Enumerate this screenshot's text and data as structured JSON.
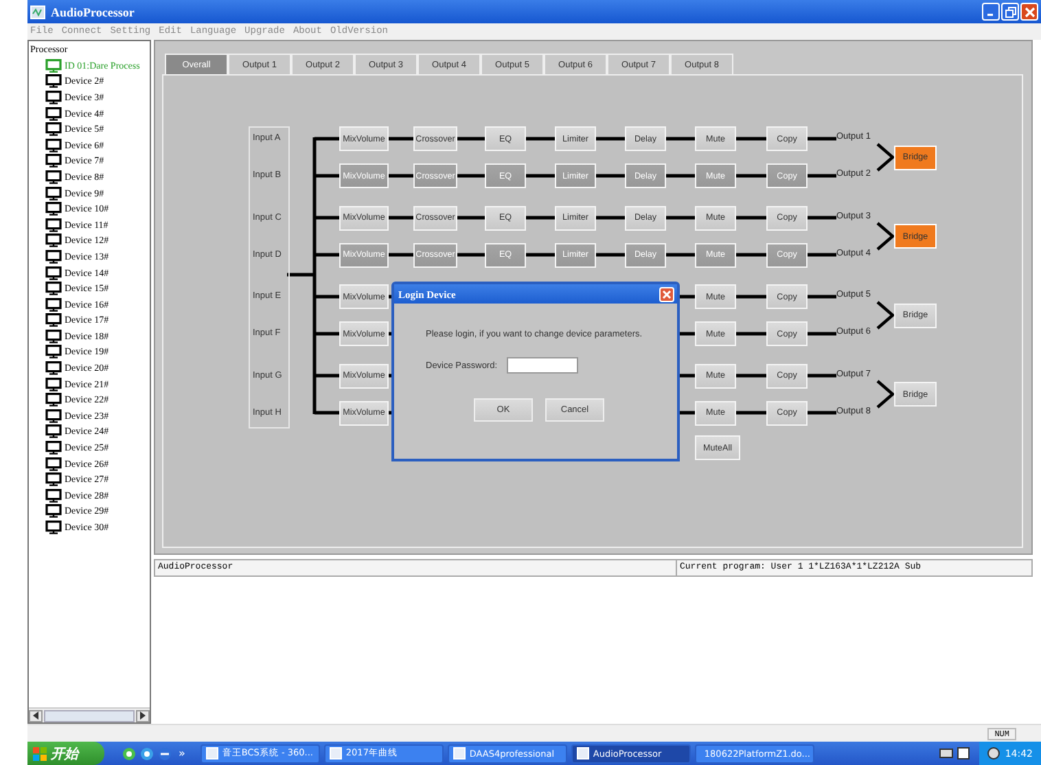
{
  "window": {
    "title": "AudioProcessor"
  },
  "menu": [
    "File",
    "Connect",
    "Setting",
    "Edit",
    "Language",
    "Upgrade",
    "About",
    "OldVersion"
  ],
  "tree": {
    "label": "Processor",
    "children": [
      {
        "label": "ID 01:Dare Process",
        "online": true
      },
      {
        "label": "Device 2#",
        "online": false
      },
      {
        "label": "Device 3#",
        "online": false
      },
      {
        "label": "Device 4#",
        "online": false
      },
      {
        "label": "Device 5#",
        "online": false
      },
      {
        "label": "Device 6#",
        "online": false
      },
      {
        "label": "Device 7#",
        "online": false
      },
      {
        "label": "Device 8#",
        "online": false
      },
      {
        "label": "Device 9#",
        "online": false
      },
      {
        "label": "Device 10#",
        "online": false
      },
      {
        "label": "Device 11#",
        "online": false
      },
      {
        "label": "Device 12#",
        "online": false
      },
      {
        "label": "Device 13#",
        "online": false
      },
      {
        "label": "Device 14#",
        "online": false
      },
      {
        "label": "Device 15#",
        "online": false
      },
      {
        "label": "Device 16#",
        "online": false
      },
      {
        "label": "Device 17#",
        "online": false
      },
      {
        "label": "Device 18#",
        "online": false
      },
      {
        "label": "Device 19#",
        "online": false
      },
      {
        "label": "Device 20#",
        "online": false
      },
      {
        "label": "Device 21#",
        "online": false
      },
      {
        "label": "Device 22#",
        "online": false
      },
      {
        "label": "Device 23#",
        "online": false
      },
      {
        "label": "Device 24#",
        "online": false
      },
      {
        "label": "Device 25#",
        "online": false
      },
      {
        "label": "Device 26#",
        "online": false
      },
      {
        "label": "Device 27#",
        "online": false
      },
      {
        "label": "Device 28#",
        "online": false
      },
      {
        "label": "Device 29#",
        "online": false
      },
      {
        "label": "Device 30#",
        "online": false
      }
    ]
  },
  "tabs": [
    {
      "label": "Overall",
      "selected": true
    },
    {
      "label": "Output 1",
      "selected": false
    },
    {
      "label": "Output 2",
      "selected": false
    },
    {
      "label": "Output 3",
      "selected": false
    },
    {
      "label": "Output 4",
      "selected": false
    },
    {
      "label": "Output 5",
      "selected": false
    },
    {
      "label": "Output 6",
      "selected": false
    },
    {
      "label": "Output 7",
      "selected": false
    },
    {
      "label": "Output 8",
      "selected": false
    }
  ],
  "inputs": [
    "Input A",
    "Input B",
    "Input C",
    "Input D",
    "Input E",
    "Input F",
    "Input G",
    "Input H"
  ],
  "channels": [
    {
      "disabled": false,
      "output": "Output 1",
      "blocks": [
        {
          "kind": "mix",
          "label": "MixVolume"
        },
        {
          "kind": "crossover",
          "label": "Crossover"
        },
        {
          "kind": "eq",
          "label": "EQ"
        },
        {
          "kind": "limiter",
          "label": "Limiter"
        },
        {
          "kind": "delay",
          "label": "Delay"
        },
        {
          "kind": "mute",
          "label": "Mute"
        },
        {
          "kind": "copy",
          "label": "Copy"
        }
      ]
    },
    {
      "disabled": true,
      "output": "Output 2",
      "blocks": [
        {
          "kind": "mix",
          "label": "MixVolume"
        },
        {
          "kind": "crossover",
          "label": "Crossover"
        },
        {
          "kind": "eq",
          "label": "EQ"
        },
        {
          "kind": "limiter",
          "label": "Limiter"
        },
        {
          "kind": "delay",
          "label": "Delay"
        },
        {
          "kind": "mute",
          "label": "Mute"
        },
        {
          "kind": "copy",
          "label": "Copy"
        }
      ]
    },
    {
      "disabled": false,
      "output": "Output 3",
      "blocks": [
        {
          "kind": "mix",
          "label": "MixVolume"
        },
        {
          "kind": "crossover",
          "label": "Crossover"
        },
        {
          "kind": "eq",
          "label": "EQ"
        },
        {
          "kind": "limiter",
          "label": "Limiter"
        },
        {
          "kind": "delay",
          "label": "Delay"
        },
        {
          "kind": "mute",
          "label": "Mute"
        },
        {
          "kind": "copy",
          "label": "Copy"
        }
      ]
    },
    {
      "disabled": true,
      "output": "Output 4",
      "blocks": [
        {
          "kind": "mix",
          "label": "MixVolume"
        },
        {
          "kind": "crossover",
          "label": "Crossover"
        },
        {
          "kind": "eq",
          "label": "EQ"
        },
        {
          "kind": "limiter",
          "label": "Limiter"
        },
        {
          "kind": "delay",
          "label": "Delay"
        },
        {
          "kind": "mute",
          "label": "Mute"
        },
        {
          "kind": "copy",
          "label": "Copy"
        }
      ]
    },
    {
      "disabled": false,
      "output": "Output 5",
      "blocks": [
        {
          "kind": "mix",
          "label": "MixVolume"
        },
        {
          "kind": "mute",
          "label": "Mute"
        },
        {
          "kind": "copy",
          "label": "Copy"
        }
      ]
    },
    {
      "disabled": false,
      "output": "Output 6",
      "blocks": [
        {
          "kind": "mix",
          "label": "MixVolume"
        },
        {
          "kind": "mute",
          "label": "Mute"
        },
        {
          "kind": "copy",
          "label": "Copy"
        }
      ]
    },
    {
      "disabled": false,
      "output": "Output 7",
      "blocks": [
        {
          "kind": "mix",
          "label": "MixVolume"
        },
        {
          "kind": "mute",
          "label": "Mute"
        },
        {
          "kind": "copy",
          "label": "Copy"
        }
      ]
    },
    {
      "disabled": false,
      "output": "Output 8",
      "blocks": [
        {
          "kind": "mix",
          "label": "MixVolume"
        },
        {
          "kind": "mute",
          "label": "Mute"
        },
        {
          "kind": "copy",
          "label": "Copy"
        }
      ]
    }
  ],
  "bridges": [
    {
      "label": "Bridge",
      "on": true
    },
    {
      "label": "Bridge",
      "on": true
    },
    {
      "label": "Bridge",
      "on": false
    },
    {
      "label": "Bridge",
      "on": false
    }
  ],
  "mute_all": "MuteAll",
  "dialog": {
    "title": "Login Device",
    "message": "Please login, if you want to change device parameters.",
    "password_label": "Device Password:",
    "ok": "OK",
    "cancel": "Cancel"
  },
  "status_bar": {
    "left": "AudioProcessor",
    "right": "Current program: User 1 1*LZ163A*1*LZ212A  Sub"
  },
  "keyboard_indicator": "NUM",
  "taskbar": {
    "start": "开始",
    "more": "»",
    "tasks": [
      {
        "label": "音王BCS系统 - 360...",
        "selected": false
      },
      {
        "label": "2017年曲线",
        "selected": false
      },
      {
        "label": "DAAS4professional",
        "selected": false
      },
      {
        "label": "AudioProcessor",
        "selected": true
      },
      {
        "label": "180622PlatformZ1.do...",
        "selected": false
      }
    ],
    "clock": "14:42"
  }
}
